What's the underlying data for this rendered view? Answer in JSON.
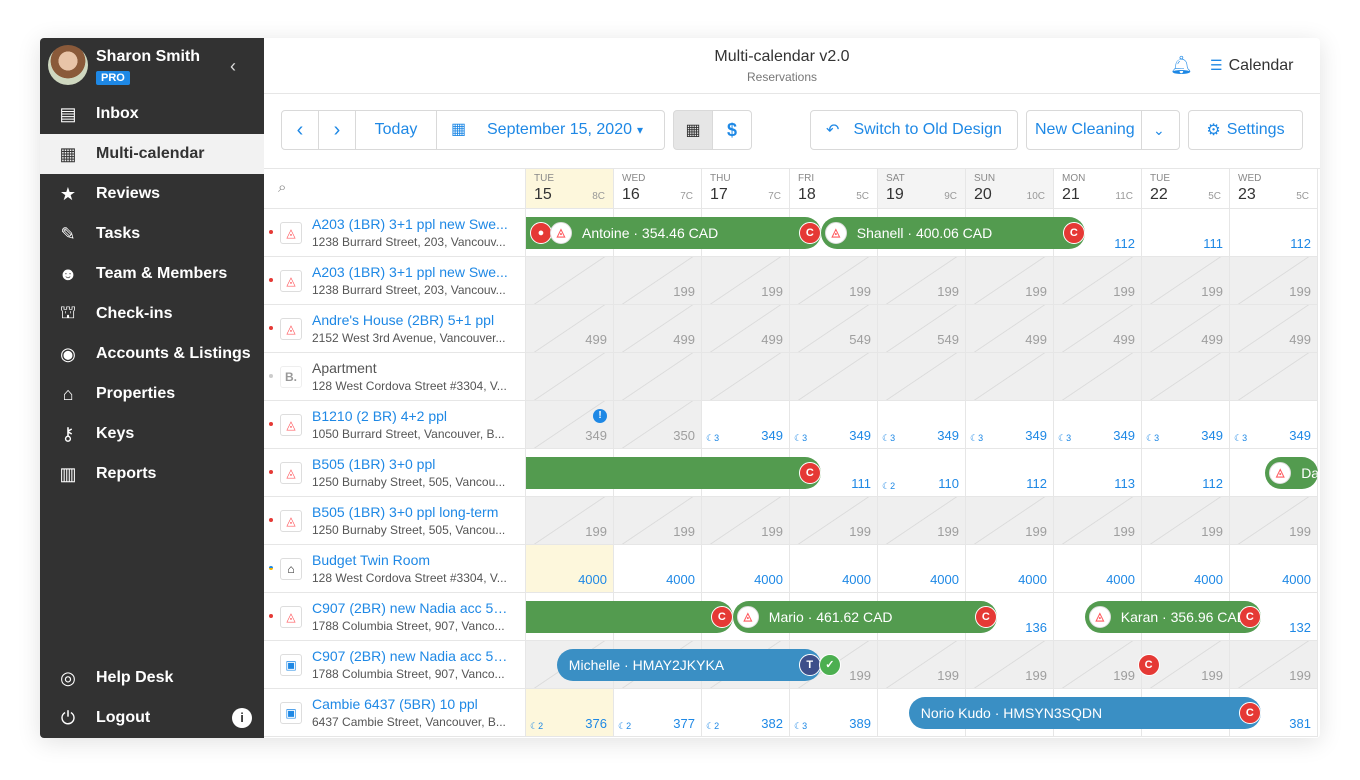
{
  "user": {
    "name": "Sharon Smith",
    "badge": "PRO"
  },
  "nav": [
    {
      "icon": "inbox-icon",
      "glyph": "▤",
      "label": "Inbox"
    },
    {
      "icon": "calendar-icon",
      "glyph": "▦",
      "label": "Multi-calendar",
      "active": true
    },
    {
      "icon": "star-icon",
      "glyph": "★",
      "label": "Reviews"
    },
    {
      "icon": "broom-icon",
      "glyph": "✎",
      "label": "Tasks"
    },
    {
      "icon": "team-icon",
      "glyph": "☻",
      "label": "Team & Members"
    },
    {
      "icon": "bell-service-icon",
      "glyph": "⛫",
      "label": "Check-ins"
    },
    {
      "icon": "account-icon",
      "glyph": "◉",
      "label": "Accounts & Listings"
    },
    {
      "icon": "home-icon",
      "glyph": "⌂",
      "label": "Properties"
    },
    {
      "icon": "key-icon",
      "glyph": "⚷",
      "label": "Keys"
    },
    {
      "icon": "reports-icon",
      "glyph": "▥",
      "label": "Reports"
    }
  ],
  "nav_bottom": [
    {
      "icon": "lifebuoy-icon",
      "glyph": "◎",
      "label": "Help Desk"
    },
    {
      "icon": "power-icon",
      "glyph": "⏻",
      "label": "Logout"
    }
  ],
  "header": {
    "title": "Multi-calendar v2.0",
    "subtitle": "Reservations",
    "calendar_link": "Calendar"
  },
  "toolbar": {
    "prev": "‹",
    "next": "›",
    "today": "Today",
    "date": "September 15, 2020",
    "switch_old": "Switch to Old Design",
    "new_cleaning": "New Cleaning",
    "settings": "Settings"
  },
  "days": [
    {
      "dow": "TUE",
      "num": "15",
      "temp": "8C",
      "today": true
    },
    {
      "dow": "WED",
      "num": "16",
      "temp": "7C"
    },
    {
      "dow": "THU",
      "num": "17",
      "temp": "7C"
    },
    {
      "dow": "FRI",
      "num": "18",
      "temp": "5C"
    },
    {
      "dow": "SAT",
      "num": "19",
      "temp": "9C",
      "weekend": true
    },
    {
      "dow": "SUN",
      "num": "20",
      "temp": "10C",
      "weekend": true
    },
    {
      "dow": "MON",
      "num": "21",
      "temp": "11C"
    },
    {
      "dow": "TUE",
      "num": "22",
      "temp": "5C"
    },
    {
      "dow": "WED",
      "num": "23",
      "temp": "5C"
    }
  ],
  "listings": [
    {
      "name": "A203 (1BR) 3+1 ppl new Swe...",
      "addr": "1238 Burrard Street, 203, Vancouv...",
      "src": "airbnb",
      "dot": "red",
      "cells": [
        {
          "p": ""
        },
        {
          "p": ""
        },
        {
          "p": ""
        },
        {
          "p": ""
        },
        {
          "p": ""
        },
        {
          "p": ""
        },
        {
          "p": "112"
        },
        {
          "p": "111"
        },
        {
          "p": "112"
        }
      ]
    },
    {
      "name": "A203 (1BR) 3+1 ppl new Swe...",
      "addr": "1238 Burrard Street, 203, Vancouv...",
      "src": "airbnb",
      "dot": "red",
      "cells": [
        {
          "p": "",
          "b": 1
        },
        {
          "p": "199",
          "b": 1
        },
        {
          "p": "199",
          "b": 1
        },
        {
          "p": "199",
          "b": 1
        },
        {
          "p": "199",
          "b": 1
        },
        {
          "p": "199",
          "b": 1
        },
        {
          "p": "199",
          "b": 1
        },
        {
          "p": "199",
          "b": 1
        },
        {
          "p": "199",
          "b": 1
        }
      ]
    },
    {
      "name": "Andre's House (2BR) 5+1 ppl",
      "addr": "2152 West 3rd Avenue, Vancouver...",
      "src": "airbnb",
      "dot": "red",
      "cells": [
        {
          "p": "499",
          "b": 1
        },
        {
          "p": "499",
          "b": 1
        },
        {
          "p": "499",
          "b": 1
        },
        {
          "p": "549",
          "b": 1
        },
        {
          "p": "549",
          "b": 1
        },
        {
          "p": "499",
          "b": 1
        },
        {
          "p": "499",
          "b": 1
        },
        {
          "p": "499",
          "b": 1
        },
        {
          "p": "499",
          "b": 1
        }
      ]
    },
    {
      "name": "Apartment",
      "addr": "128 West Cordova Street #3304, V...",
      "src": "letter",
      "dot": "grey",
      "plain": true,
      "cells": [
        {
          "p": "",
          "b": 1
        },
        {
          "p": "",
          "b": 1
        },
        {
          "p": "",
          "b": 1
        },
        {
          "p": "",
          "b": 1
        },
        {
          "p": "",
          "b": 1
        },
        {
          "p": "",
          "b": 1
        },
        {
          "p": "",
          "b": 1
        },
        {
          "p": "",
          "b": 1
        },
        {
          "p": "",
          "b": 1
        }
      ]
    },
    {
      "name": "B1210 (2 BR) 4+2 ppl",
      "addr": "1050 Burrard Street, Vancouver, B...",
      "src": "airbnb",
      "dot": "red",
      "cells": [
        {
          "p": "349",
          "b": 1,
          "w": 1
        },
        {
          "p": "350",
          "b": 1
        },
        {
          "p": "349",
          "m": "3"
        },
        {
          "p": "349",
          "m": "3"
        },
        {
          "p": "349",
          "m": "3"
        },
        {
          "p": "349",
          "m": "3"
        },
        {
          "p": "349",
          "m": "3"
        },
        {
          "p": "349",
          "m": "3"
        },
        {
          "p": "349",
          "m": "3"
        }
      ]
    },
    {
      "name": "B505 (1BR) 3+0 ppl",
      "addr": "1250 Burnaby Street, 505, Vancou...",
      "src": "airbnb",
      "dot": "red",
      "cells": [
        {
          "p": ""
        },
        {
          "p": ""
        },
        {
          "p": ""
        },
        {
          "p": "111",
          "m": "3"
        },
        {
          "p": "110",
          "m": "2"
        },
        {
          "p": "112"
        },
        {
          "p": "113"
        },
        {
          "p": "112"
        },
        {
          "p": ""
        }
      ]
    },
    {
      "name": "B505 (1BR) 3+0 ppl long-term",
      "addr": "1250 Burnaby Street, 505, Vancou...",
      "src": "airbnb",
      "dot": "red",
      "cells": [
        {
          "p": "199",
          "b": 1
        },
        {
          "p": "199",
          "b": 1
        },
        {
          "p": "199",
          "b": 1
        },
        {
          "p": "199",
          "b": 1
        },
        {
          "p": "199",
          "b": 1
        },
        {
          "p": "199",
          "b": 1
        },
        {
          "p": "199",
          "b": 1
        },
        {
          "p": "199",
          "b": 1
        },
        {
          "p": "199",
          "b": 1
        }
      ]
    },
    {
      "name": "Budget Twin Room",
      "addr": "128 West Cordova Street #3304, V...",
      "src": "house",
      "dot": "multi",
      "cells": [
        {
          "p": "4000",
          "t": 1
        },
        {
          "p": "4000"
        },
        {
          "p": "4000"
        },
        {
          "p": "4000"
        },
        {
          "p": "4000"
        },
        {
          "p": "4000"
        },
        {
          "p": "4000"
        },
        {
          "p": "4000"
        },
        {
          "p": "4000"
        }
      ]
    },
    {
      "name": "C907 (2BR) new Nadia acc 5+...",
      "addr": "1788 Columbia Street, 907, Vanco...",
      "src": "airbnb",
      "dot": "red",
      "cells": [
        {
          "p": ""
        },
        {
          "p": ""
        },
        {
          "p": ""
        },
        {
          "p": ""
        },
        {
          "p": ""
        },
        {
          "p": "136"
        },
        {
          "p": ""
        },
        {
          "p": ""
        },
        {
          "p": "132"
        }
      ]
    },
    {
      "name": "C907 (2BR) new Nadia acc 5+...",
      "addr": "1788 Columbia Street, 907, Vanco...",
      "src": "booking",
      "dot": "none",
      "cells": [
        {
          "p": "",
          "b": 1
        },
        {
          "p": "",
          "b": 1
        },
        {
          "p": "",
          "b": 1
        },
        {
          "p": "199",
          "b": 1
        },
        {
          "p": "199",
          "b": 1
        },
        {
          "p": "199",
          "b": 1
        },
        {
          "p": "199",
          "b": 1
        },
        {
          "p": "199",
          "b": 1
        },
        {
          "p": "199",
          "b": 1
        }
      ]
    },
    {
      "name": "Cambie 6437 (5BR) 10 ppl",
      "addr": "6437 Cambie Street, Vancouver, B...",
      "src": "booking",
      "dot": "none",
      "cells": [
        {
          "p": "376",
          "m": "2",
          "t": 1
        },
        {
          "p": "377",
          "m": "2"
        },
        {
          "p": "382",
          "m": "2"
        },
        {
          "p": "389",
          "m": "3"
        },
        {
          "p": ""
        },
        {
          "p": ""
        },
        {
          "p": ""
        },
        {
          "p": ""
        },
        {
          "p": "381"
        }
      ]
    }
  ],
  "reservations": [
    {
      "row": 0,
      "guest": "Antoine · 354.46 CAD",
      "color": "green",
      "startCol": -0.5,
      "endCol": 3.35,
      "chips": [
        "red-person",
        "air"
      ],
      "endChip": "C"
    },
    {
      "row": 0,
      "guest": "Shanell · 400.06 CAD",
      "color": "green",
      "startCol": 3.35,
      "endCol": 6.35,
      "chips": [
        "air"
      ],
      "endChip": "C"
    },
    {
      "row": 5,
      "guest": "",
      "color": "green",
      "startCol": -0.5,
      "endCol": 3.35,
      "chips": [],
      "endChip": "C"
    },
    {
      "row": 5,
      "guest": "Da",
      "color": "green",
      "startCol": 8.4,
      "endCol": 9.4,
      "chips": [
        "air"
      ],
      "endChip": ""
    },
    {
      "row": 8,
      "guest": "",
      "color": "green",
      "startCol": -0.5,
      "endCol": 2.35,
      "chips": [],
      "endChip": "C"
    },
    {
      "row": 8,
      "guest": "Mario · 461.62 CAD",
      "color": "green",
      "startCol": 2.35,
      "endCol": 5.35,
      "chips": [
        "air"
      ],
      "endChip": "C"
    },
    {
      "row": 8,
      "guest": "Karan · 356.96 CAD",
      "color": "green",
      "startCol": 6.35,
      "endCol": 8.35,
      "chips": [
        "air"
      ],
      "endChip": "C"
    },
    {
      "row": 9,
      "guest": "Michelle · HMAY2JKYKA",
      "color": "blue",
      "startCol": 0.35,
      "endCol": 3.35,
      "chips": [],
      "endChip": "T",
      "extra": "ok"
    },
    {
      "row": 9,
      "guest": "",
      "color": "none",
      "startCol": 7.2,
      "endCol": 7.2,
      "chips": [],
      "endChip": "C"
    },
    {
      "row": 10,
      "guest": "Norio Kudo · HMSYN3SQDN",
      "color": "blue",
      "startCol": 4.35,
      "endCol": 8.35,
      "chips": [],
      "endChip": "C"
    }
  ]
}
